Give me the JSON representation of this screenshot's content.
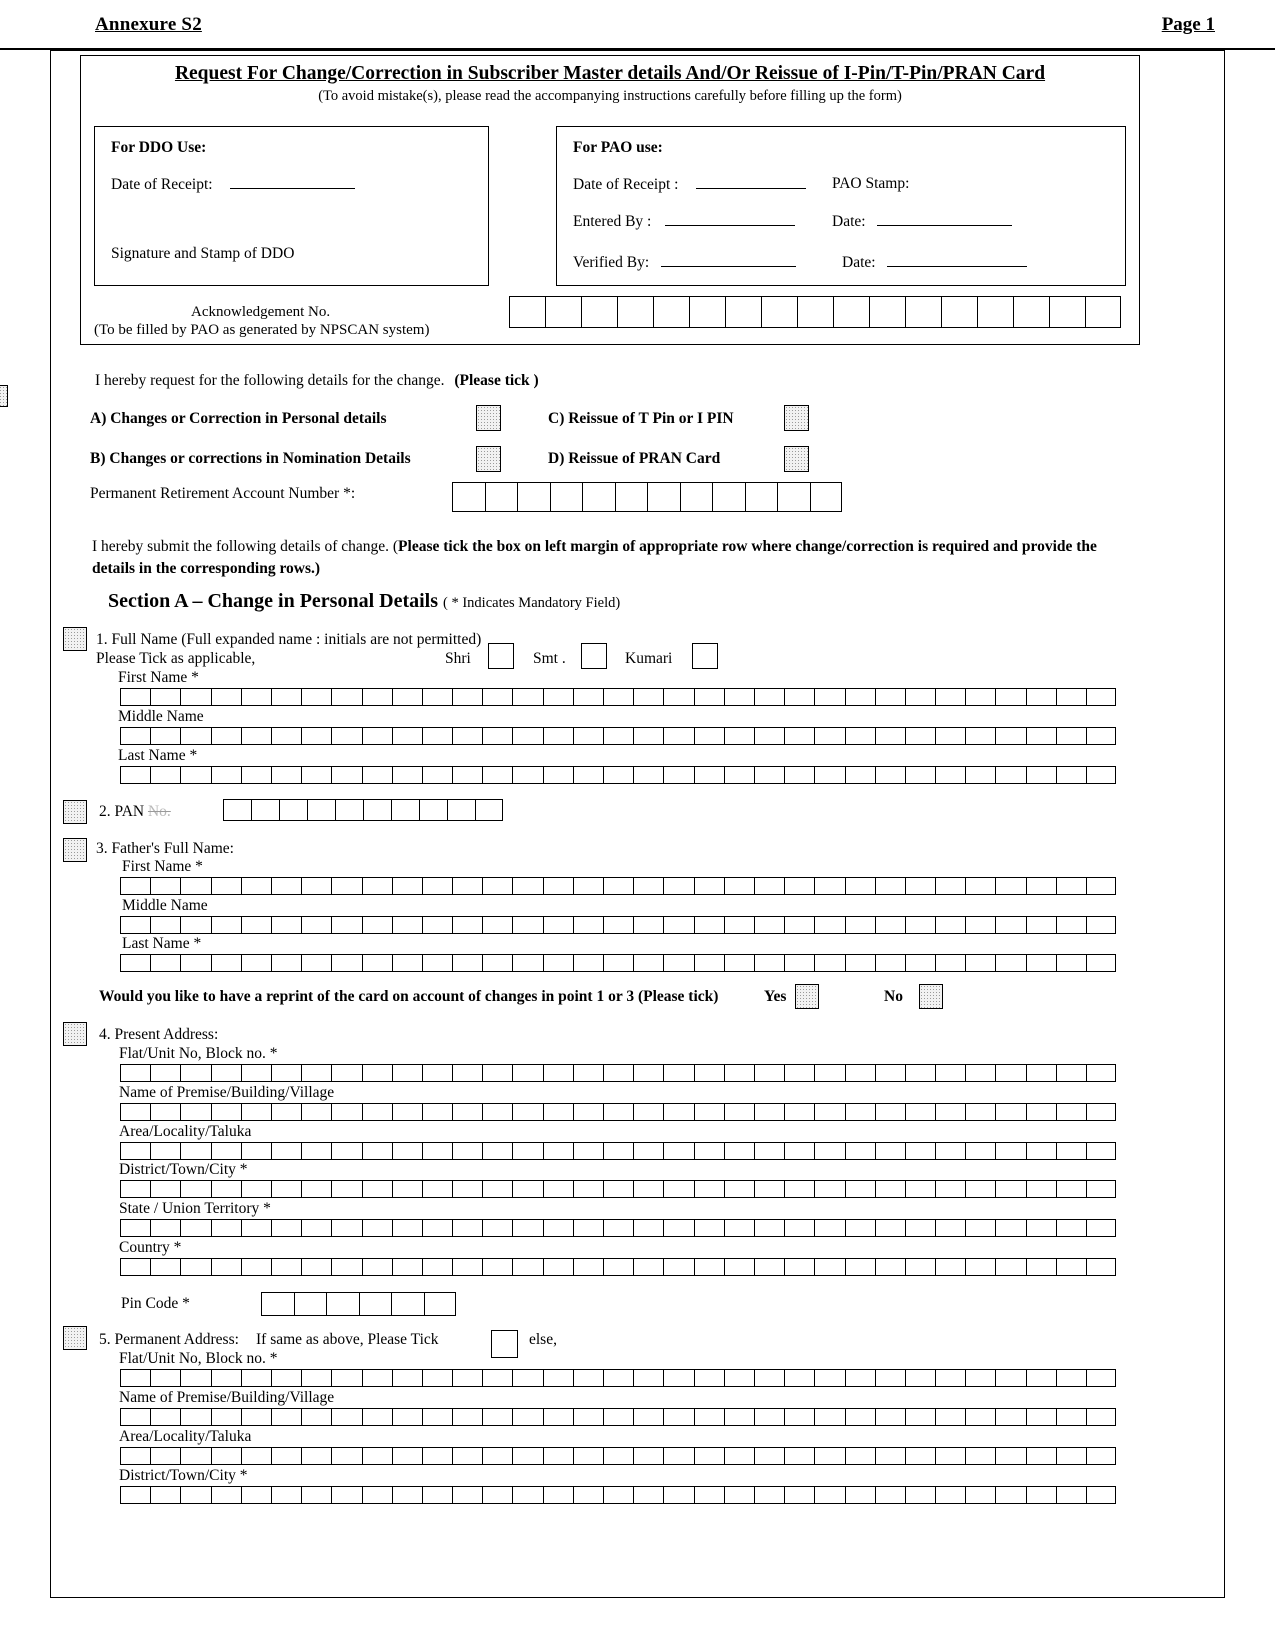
{
  "header": {
    "annexure": "Annexure S2",
    "page_label": "Page 1"
  },
  "form": {
    "title": "Request For Change/Correction in Subscriber Master details And/Or Reissue of I-Pin/T-Pin/PRAN Card",
    "subtitle": "(To avoid mistake(s), please read the accompanying instructions carefully  before filling up the form)"
  },
  "ddo": {
    "heading": "For DDO Use:",
    "date_of_receipt_label": "Date of Receipt:",
    "signature_label": "Signature and Stamp of DDO"
  },
  "pao": {
    "heading": "For PAO use:",
    "date_of_receipt_label": "Date of Receipt :",
    "pao_stamp_label": "PAO Stamp:",
    "entered_by_label": "Entered By :",
    "entered_date_label": "Date:",
    "verified_by_label": "Verified By:",
    "verified_date_label": "Date:"
  },
  "acknowledgement": {
    "line1": "Acknowledgement No.",
    "line2": "(To be filled by PAO as generated by NPSCAN system)",
    "cells": 17
  },
  "request": {
    "intro_plain": "I hereby request for the following details for the change.",
    "intro_bold": "(Please tick )",
    "options": [
      {
        "label": "A) Changes or Correction in Personal details",
        "checked": false
      },
      {
        "label": "B)  Changes or corrections in Nomination Details",
        "checked": false
      },
      {
        "label": "C)   Reissue of  T Pin or I PIN",
        "checked": false
      },
      {
        "label": "D)  Reissue of  PRAN Card",
        "checked": false
      }
    ],
    "pran_label": "Permanent Retirement Account Number  *:",
    "pran_cells": 12
  },
  "submit_note": {
    "plain1": "I hereby submit the following details of change. (",
    "bold": "Please tick the box on left margin of appropriate row where change/correction is required and provide the details in the corresponding rows.)"
  },
  "section_a": {
    "title": "Section  A – Change in Personal Details",
    "note": "( * Indicates Mandatory Field)"
  },
  "fields": {
    "full_name": {
      "number_label": "1. Full Name (Full expanded name : initials are not permitted)",
      "tick_label": "Please Tick   as applicable,",
      "titles": [
        "Shri",
        "Smt .",
        "Kumari"
      ],
      "rows": [
        {
          "label": "First Name *",
          "cells": 33
        },
        {
          "label": "Middle Name",
          "cells": 33
        },
        {
          "label": "Last Name *",
          "cells": 33
        }
      ]
    },
    "pan": {
      "number_label": "2. PAN",
      "strike_label": "No.",
      "cells": 10
    },
    "father_name": {
      "number_label": "3.  Father's Full Name:",
      "rows": [
        {
          "label": "First Name *",
          "cells": 33
        },
        {
          "label": "Middle Name",
          "cells": 33
        },
        {
          "label": "Last Name *",
          "cells": 33
        }
      ]
    },
    "reprint": {
      "question": "Would you like to have a reprint of the card on account of changes in point 1 or 3 (Please tick)",
      "yes_label": "Yes",
      "no_label": "No"
    },
    "present_address": {
      "number_label": "4. Present Address:",
      "rows": [
        {
          "label": "Flat/Unit No, Block no. *",
          "cells": 33
        },
        {
          "label": "Name of Premise/Building/Village",
          "cells": 33
        },
        {
          "label": "Area/Locality/Taluka",
          "cells": 33
        },
        {
          "label": "District/Town/City *",
          "cells": 33
        },
        {
          "label": "State / Union Territory *",
          "cells": 33
        },
        {
          "label": "Country *",
          "cells": 33
        }
      ],
      "pin_label": "Pin Code *",
      "pin_cells": 6
    },
    "permanent_address": {
      "number_label": "5. Permanent Address:",
      "same_as_above_label": "If same as above, Please Tick",
      "else_label": "else,",
      "rows": [
        {
          "label": "Flat/Unit No, Block no. *",
          "cells": 33
        },
        {
          "label": "Name of Premise/Building/Village",
          "cells": 33
        },
        {
          "label": "Area/Locality/Taluka",
          "cells": 33
        },
        {
          "label": "District/Town/City *",
          "cells": 33
        }
      ]
    }
  },
  "colors": {
    "ink": "#000000",
    "paper": "#ffffff",
    "shaded_box": "#f2f2f2"
  }
}
